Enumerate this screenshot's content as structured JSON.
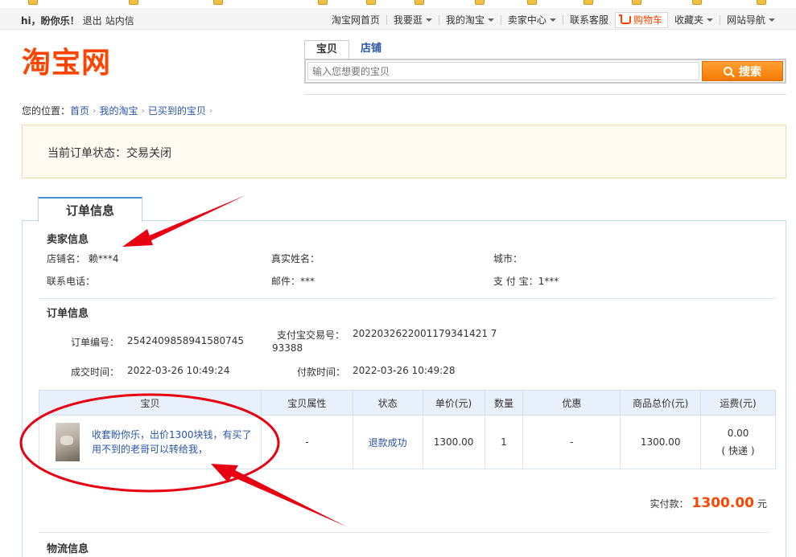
{
  "site_nav": {
    "greeting": "hi，盼你乐！",
    "logout": "退出",
    "messages": "站内信",
    "links": [
      {
        "label": "淘宝网首页",
        "caret": false
      },
      {
        "label": "我要逛",
        "caret": true
      },
      {
        "label": "我的淘宝",
        "caret": true
      },
      {
        "label": "卖家中心",
        "caret": true
      },
      {
        "label": "联系客服",
        "caret": false
      },
      {
        "label": "购物车",
        "caret": false
      },
      {
        "label": "收藏夹",
        "caret": true
      },
      {
        "label": "网站导航",
        "caret": true
      }
    ]
  },
  "header": {
    "logo": "淘宝网",
    "search_tabs": [
      "宝贝",
      "店铺"
    ],
    "search_placeholder": "输入您想要的宝贝",
    "search_button": "搜索"
  },
  "breadcrumb": {
    "prefix": "您的位置：",
    "items": [
      "首页",
      "我的淘宝",
      "已买到的宝贝"
    ]
  },
  "order_status": "当前订单状态：交易关闭",
  "order_tab": "订单信息",
  "seller": {
    "title": "卖家信息",
    "shop_name_label": "店铺名：",
    "shop_name": "赖***4",
    "real_name_label": "真实姓名：",
    "city_label": "城市：",
    "phone_label": "联系电话：",
    "email_label": "邮件：",
    "email": "***",
    "alipay_label": "支 付 宝：",
    "alipay": "1***"
  },
  "order": {
    "title": "订单信息",
    "order_no_label": "订单编号：",
    "order_no": "2542409858941580745",
    "alipay_tx_label": "支付宝交易号：",
    "alipay_tx_line1": "2022032622001179341421 7",
    "alipay_tx_line2": "93388",
    "deal_time_label": "成交时间：",
    "deal_time": "2022-03-26 10:49:24",
    "pay_time_label": "付款时间：",
    "pay_time": "2022-03-26 10:49:28"
  },
  "table": {
    "headers": [
      "宝贝",
      "宝贝属性",
      "状态",
      "单价(元)",
      "数量",
      "优惠",
      "商品总价(元)",
      "运费(元)"
    ],
    "row": {
      "title": "收套盼你乐，出价1300块钱，有买了用不到的老哥可以转给我，",
      "attribute": "-",
      "status": "退款成功",
      "unit_price": "1300.00",
      "quantity": "1",
      "discount": "-",
      "total": "1300.00",
      "shipping": "0.00",
      "shipping_method": "( 快递 )"
    }
  },
  "paid": {
    "label": "实付款：",
    "amount": "1300.00",
    "unit": "元"
  },
  "logistics_title": "物流信息",
  "colors": {
    "brand": "#ff4400",
    "link": "#2953a6",
    "annotation": "#e60012"
  }
}
